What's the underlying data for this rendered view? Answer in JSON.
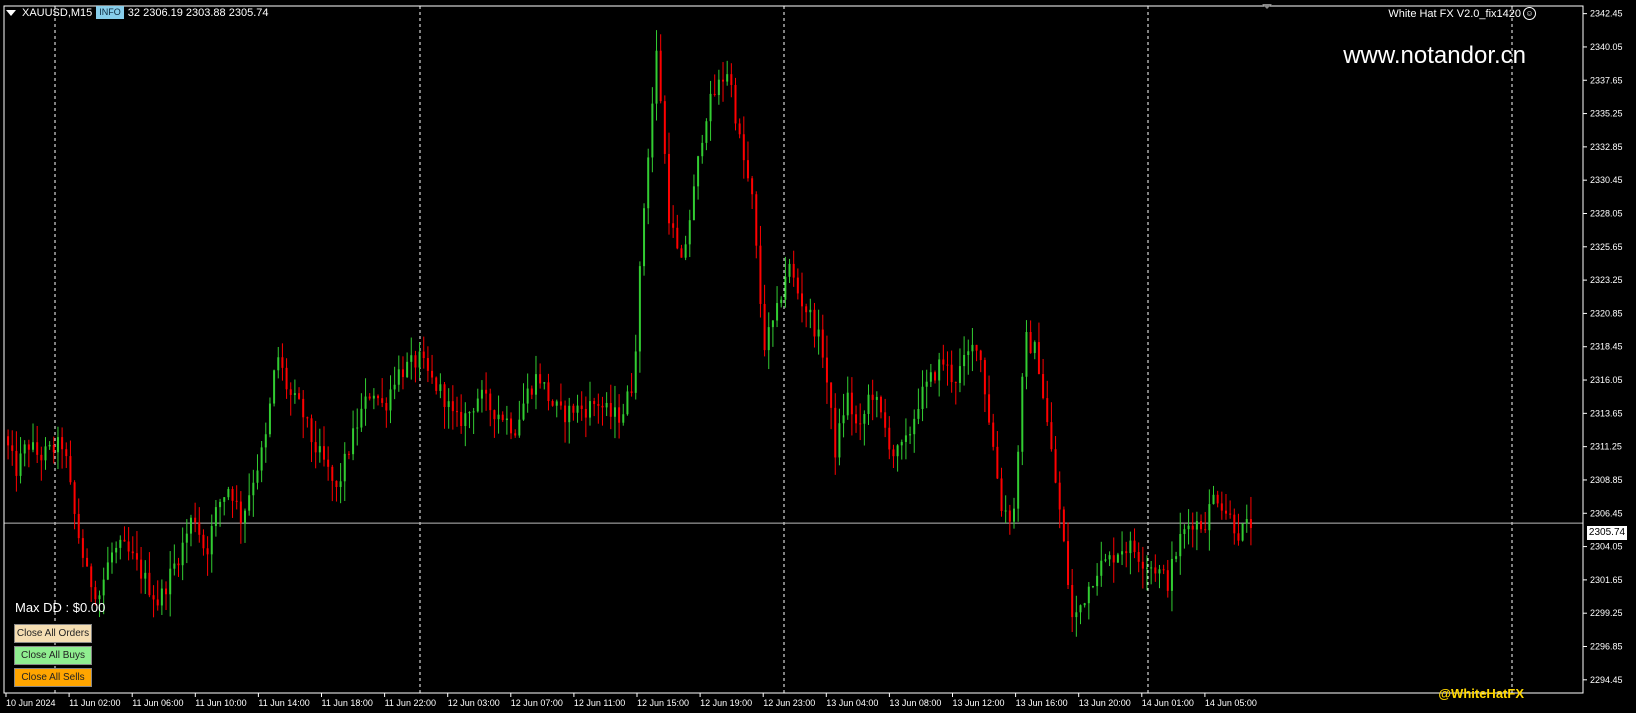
{
  "header": {
    "symbol": "XAUUSD,M15",
    "info_badge": "INFO",
    "ohlc": "32 2306.19 2303.88 2305.74",
    "ea_name": "White Hat FX V2.0_fix1420",
    "ea_icon": "smiley-icon"
  },
  "watermark": "www.notandor.cn",
  "panel": {
    "max_dd": "Max DD : $0.00",
    "close_all_orders": "Close All Orders",
    "close_all_buys": "Close All Buys",
    "close_all_sells": "Close All Sells",
    "orders_color": "#F5DEB3",
    "buys_color": "#90EE90",
    "sells_color": "#FFA500"
  },
  "handle": "@WhiteHatFX",
  "colors": {
    "bull": "#32CD32",
    "bear": "#FF0000",
    "background": "#000000",
    "axis": "#FFFFFF"
  },
  "chart_data": {
    "type": "candlestick",
    "current_price": 2305.74,
    "current_price_label": "2305.74",
    "ylim": [
      2293.5,
      2343.0
    ],
    "yticks": [
      "2342.45",
      "2340.05",
      "2337.65",
      "2335.25",
      "2332.85",
      "2330.45",
      "2328.05",
      "2325.65",
      "2323.25",
      "2320.85",
      "2318.45",
      "2316.05",
      "2313.65",
      "2311.25",
      "2308.85",
      "2306.45",
      "2304.05",
      "2301.65",
      "2299.25",
      "2296.85",
      "2294.45"
    ],
    "xticks": [
      "10 Jun 2024",
      "11 Jun 02:00",
      "11 Jun 06:00",
      "11 Jun 10:00",
      "11 Jun 14:00",
      "11 Jun 18:00",
      "11 Jun 22:00",
      "12 Jun 03:00",
      "12 Jun 07:00",
      "12 Jun 11:00",
      "12 Jun 15:00",
      "12 Jun 19:00",
      "12 Jun 23:00",
      "13 Jun 04:00",
      "13 Jun 08:00",
      "13 Jun 12:00",
      "13 Jun 16:00",
      "13 Jun 20:00",
      "14 Jun 01:00",
      "14 Jun 05:00"
    ],
    "closes": [
      2312.0,
      2309.5,
      2311.5,
      2310.5,
      2311.0,
      2311.5,
      2306.0,
      2302.0,
      2300.5,
      2303.5,
      2304.0,
      2303.0,
      2301.5,
      2300.0,
      2302.0,
      2304.0,
      2306.5,
      2303.5,
      2307.0,
      2308.5,
      2306.0,
      2309.0,
      2311.5,
      2318.0,
      2315.0,
      2314.0,
      2311.5,
      2310.0,
      2308.0,
      2311.0,
      2313.5,
      2315.5,
      2314.0,
      2316.5,
      2317.0,
      2317.5,
      2316.0,
      2315.0,
      2313.0,
      2313.5,
      2315.0,
      2314.0,
      2313.5,
      2312.5,
      2315.0,
      2316.5,
      2314.5,
      2313.5,
      2314.0,
      2314.0,
      2314.5,
      2313.5,
      2313.5,
      2316.0,
      2330.0,
      2340.0,
      2328.0,
      2324.0,
      2329.0,
      2335.0,
      2337.0,
      2338.5,
      2333.0,
      2329.0,
      2318.5,
      2320.5,
      2324.5,
      2322.0,
      2320.5,
      2318.0,
      2311.0,
      2315.0,
      2312.0,
      2315.5,
      2313.0,
      2310.5,
      2311.5,
      2314.5,
      2316.0,
      2317.5,
      2316.0,
      2317.5,
      2319.0,
      2313.0,
      2307.0,
      2306.0,
      2319.0,
      2318.0,
      2312.0,
      2306.0,
      2298.5,
      2300.5,
      2302.5,
      2303.0,
      2304.0,
      2304.0,
      2303.0,
      2302.5,
      2301.5,
      2304.5,
      2306.0,
      2305.5,
      2308.0,
      2306.5,
      2305.0,
      2305.74
    ]
  }
}
